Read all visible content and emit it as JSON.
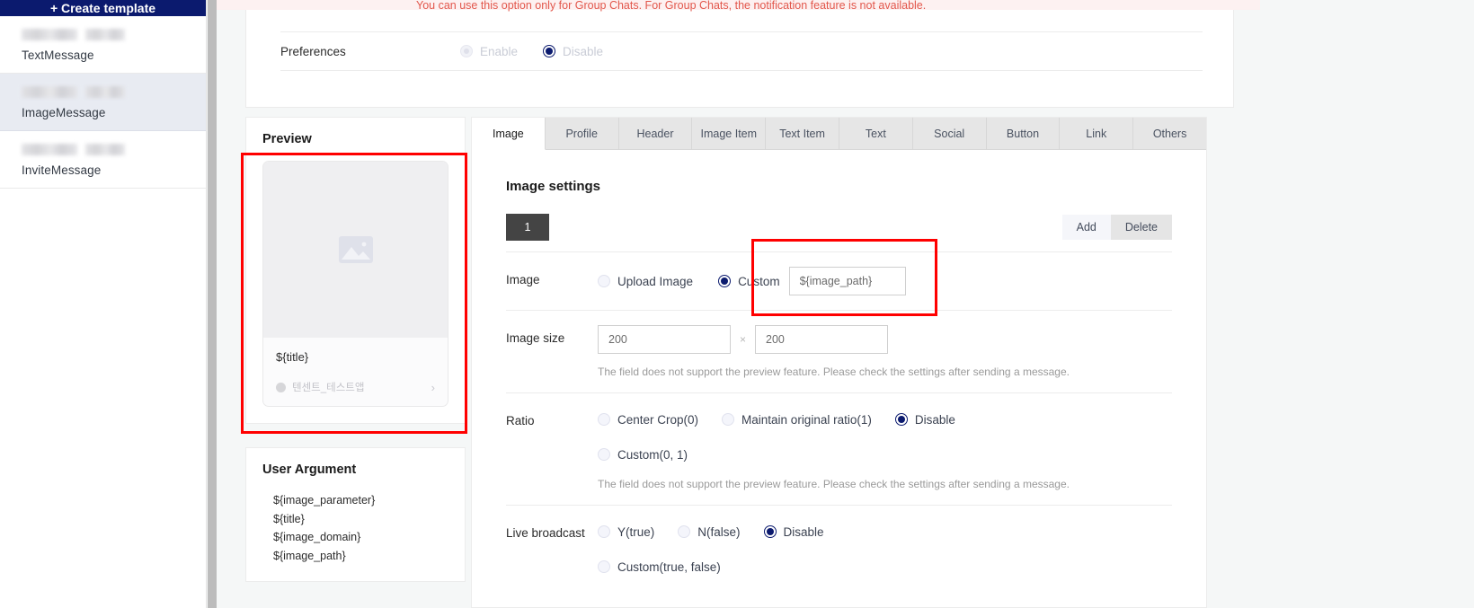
{
  "sidebar": {
    "create_button_label": "+ Create template",
    "items": [
      {
        "label": "TextMessage",
        "selected": false
      },
      {
        "label": "ImageMessage",
        "selected": true
      },
      {
        "label": "InviteMessage",
        "selected": false
      }
    ]
  },
  "notice": {
    "text": "You can use this option only for Group Chats. For Group Chats, the notification feature is not available."
  },
  "preferences": {
    "label": "Preferences",
    "options": [
      {
        "label": "Enable",
        "selected": false,
        "disabled": true
      },
      {
        "label": "Disable",
        "selected": true,
        "disabled": false
      }
    ]
  },
  "preview": {
    "title": "Preview",
    "card_title": "${title}",
    "app_name": "텐센트_테스트앱",
    "chevron": "›",
    "image_placeholder_icon": "image-placeholder-icon"
  },
  "user_argument": {
    "title": "User Argument",
    "items": [
      "${image_parameter}",
      "${title}",
      "${image_domain}",
      "${image_path}"
    ]
  },
  "tabs": [
    {
      "label": "Image",
      "active": true
    },
    {
      "label": "Profile",
      "active": false
    },
    {
      "label": "Header",
      "active": false
    },
    {
      "label": "Image Item",
      "active": false
    },
    {
      "label": "Text Item",
      "active": false
    },
    {
      "label": "Text",
      "active": false
    },
    {
      "label": "Social",
      "active": false
    },
    {
      "label": "Button",
      "active": false
    },
    {
      "label": "Link",
      "active": false
    },
    {
      "label": "Others",
      "active": false
    }
  ],
  "image_settings": {
    "heading": "Image settings",
    "index_badge": "1",
    "add_label": "Add",
    "delete_label": "Delete",
    "image": {
      "label": "Image",
      "options": [
        {
          "label": "Upload Image",
          "selected": false
        },
        {
          "label": "Custom",
          "selected": true
        }
      ],
      "custom_value": "${image_path}"
    },
    "image_size": {
      "label": "Image size",
      "width": "200",
      "height": "200",
      "separator": "×",
      "hint": "The field does not support the preview feature. Please check the settings after sending a message."
    },
    "ratio": {
      "label": "Ratio",
      "options": [
        {
          "label": "Center Crop(0)",
          "selected": false
        },
        {
          "label": "Maintain original ratio(1)",
          "selected": false
        },
        {
          "label": "Disable",
          "selected": true
        },
        {
          "label": "Custom(0, 1)",
          "selected": false
        }
      ],
      "hint": "The field does not support the preview feature. Please check the settings after sending a message."
    },
    "live_broadcast": {
      "label": "Live broadcast",
      "options": [
        {
          "label": "Y(true)",
          "selected": false
        },
        {
          "label": "N(false)",
          "selected": false
        },
        {
          "label": "Disable",
          "selected": true
        },
        {
          "label": "Custom(true, false)",
          "selected": false
        }
      ]
    }
  },
  "colors": {
    "brand_navy": "#0b1a6e",
    "annotation_red": "#ff0000",
    "notice_red": "#e2574c",
    "badge_gray": "#444444",
    "selected_item_bg": "#e8ebf2"
  }
}
